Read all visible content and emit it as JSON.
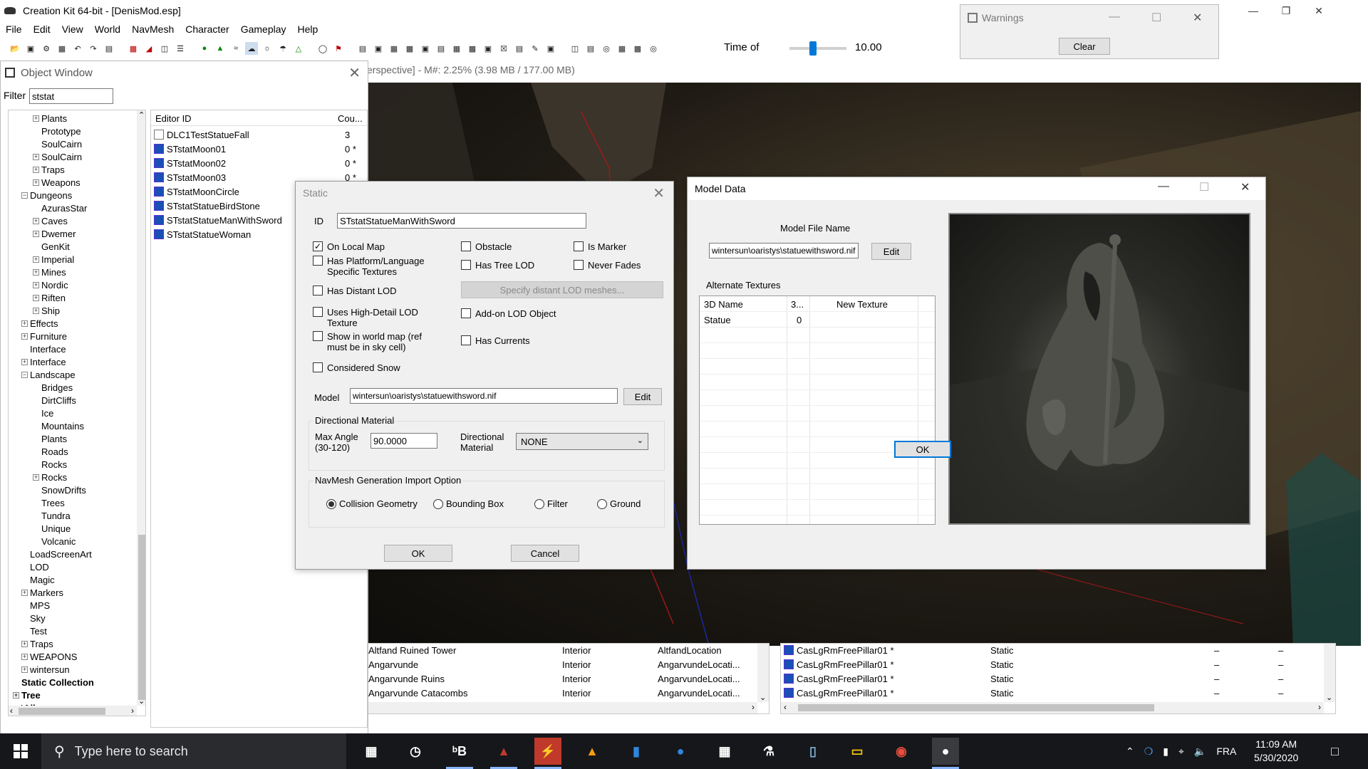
{
  "app": {
    "title": "Creation Kit 64-bit - [DenisMod.esp]"
  },
  "menu": [
    "File",
    "Edit",
    "View",
    "World",
    "NavMesh",
    "Character",
    "Gameplay",
    "Help"
  ],
  "toolbar": {
    "time_label": "Time of",
    "time_value": "10.00",
    "time_fraction": 0.4
  },
  "render": {
    "title": "erspective] - M#: 2.25% (3.98 MB / 177.00 MB)"
  },
  "warnings": {
    "title": "Warnings",
    "clear_label": "Clear"
  },
  "object_window": {
    "title": "Object Window",
    "filter_label": "Filter",
    "filter_value": "ststat",
    "tree": [
      {
        "label": "Plants",
        "expander": true,
        "level": 2
      },
      {
        "label": "Prototype",
        "expander": false,
        "level": 2
      },
      {
        "label": "SoulCairn",
        "expander": false,
        "level": 2
      },
      {
        "label": "SoulCairn",
        "expander": true,
        "level": 2
      },
      {
        "label": "Traps",
        "expander": true,
        "level": 2
      },
      {
        "label": "Weapons",
        "expander": true,
        "level": 2
      },
      {
        "label": "Dungeons",
        "expander": true,
        "level": 1,
        "open": true
      },
      {
        "label": "AzurasStar",
        "expander": false,
        "level": 2
      },
      {
        "label": "Caves",
        "expander": true,
        "level": 2
      },
      {
        "label": "Dwemer",
        "expander": true,
        "level": 2
      },
      {
        "label": "GenKit",
        "expander": false,
        "level": 2
      },
      {
        "label": "Imperial",
        "expander": true,
        "level": 2
      },
      {
        "label": "Mines",
        "expander": true,
        "level": 2
      },
      {
        "label": "Nordic",
        "expander": true,
        "level": 2
      },
      {
        "label": "Riften",
        "expander": true,
        "level": 2
      },
      {
        "label": "Ship",
        "expander": true,
        "level": 2
      },
      {
        "label": "Effects",
        "expander": true,
        "level": 1
      },
      {
        "label": "Furniture",
        "expander": true,
        "level": 1
      },
      {
        "label": "Interface",
        "expander": false,
        "level": 1
      },
      {
        "label": "Interface",
        "expander": true,
        "level": 1
      },
      {
        "label": "Landscape",
        "expander": true,
        "level": 1,
        "open": true
      },
      {
        "label": "Bridges",
        "expander": false,
        "level": 2
      },
      {
        "label": "DirtCliffs",
        "expander": false,
        "level": 2
      },
      {
        "label": "Ice",
        "expander": false,
        "level": 2
      },
      {
        "label": "Mountains",
        "expander": false,
        "level": 2
      },
      {
        "label": "Plants",
        "expander": false,
        "level": 2
      },
      {
        "label": "Roads",
        "expander": false,
        "level": 2
      },
      {
        "label": "Rocks",
        "expander": false,
        "level": 2
      },
      {
        "label": "Rocks",
        "expander": true,
        "level": 2
      },
      {
        "label": "SnowDrifts",
        "expander": false,
        "level": 2
      },
      {
        "label": "Trees",
        "expander": false,
        "level": 2
      },
      {
        "label": "Tundra",
        "expander": false,
        "level": 2
      },
      {
        "label": "Unique",
        "expander": false,
        "level": 2
      },
      {
        "label": "Volcanic",
        "expander": false,
        "level": 2
      },
      {
        "label": "LoadScreenArt",
        "expander": false,
        "level": 1
      },
      {
        "label": "LOD",
        "expander": false,
        "level": 1
      },
      {
        "label": "Magic",
        "expander": false,
        "level": 1
      },
      {
        "label": "Markers",
        "expander": true,
        "level": 1
      },
      {
        "label": "MPS",
        "expander": false,
        "level": 1
      },
      {
        "label": "Sky",
        "expander": false,
        "level": 1
      },
      {
        "label": "Test",
        "expander": false,
        "level": 1
      },
      {
        "label": "Traps",
        "expander": true,
        "level": 1
      },
      {
        "label": "WEAPONS",
        "expander": true,
        "level": 1
      },
      {
        "label": "wintersun",
        "expander": true,
        "level": 1
      },
      {
        "label": "Static Collection",
        "expander": false,
        "level": 0,
        "bold": true
      },
      {
        "label": "Tree",
        "expander": true,
        "level": 0,
        "bold": true
      },
      {
        "label": "*All",
        "expander": false,
        "level": -1,
        "bold": true
      }
    ],
    "list_headers": [
      "Editor ID",
      "Cou..."
    ],
    "list": [
      {
        "id": "DLC1TestStatueFall",
        "count": "3",
        "icon": "blank"
      },
      {
        "id": "STstatMoon01",
        "count": "0 *",
        "icon": "static"
      },
      {
        "id": "STstatMoon02",
        "count": "0 *",
        "icon": "static"
      },
      {
        "id": "STstatMoon03",
        "count": "0 *",
        "icon": "static"
      },
      {
        "id": "STstatMoonCircle",
        "count": "0 *",
        "icon": "static"
      },
      {
        "id": "STstatStatueBirdStone",
        "count": "",
        "icon": "static"
      },
      {
        "id": "STstatStatueManWithSword",
        "count": "",
        "icon": "static"
      },
      {
        "id": "STstatStatueWoman",
        "count": "",
        "icon": "static"
      }
    ]
  },
  "static_dialog": {
    "title": "Static",
    "id_label": "ID",
    "id_value": "STstatStatueManWithSword",
    "checks": {
      "on_local_map": {
        "label": "On Local Map",
        "checked": true
      },
      "obstacle": {
        "label": "Obstacle",
        "checked": false
      },
      "is_marker": {
        "label": "Is Marker",
        "checked": false
      },
      "has_platform": {
        "label": "Has Platform/Language Specific Textures",
        "checked": false
      },
      "has_tree_lod": {
        "label": "Has Tree LOD",
        "checked": false
      },
      "never_fades": {
        "label": "Never Fades",
        "checked": false
      },
      "has_distant_lod": {
        "label": "Has Distant LOD",
        "checked": false
      },
      "uses_high_detail": {
        "label": "Uses High-Detail LOD Texture",
        "checked": false
      },
      "addon_lod": {
        "label": "Add-on LOD Object",
        "checked": false
      },
      "show_world_map": {
        "label": "Show in world map (ref must be in sky cell)",
        "checked": false
      },
      "has_currents": {
        "label": "Has Currents",
        "checked": false
      },
      "considered_snow": {
        "label": "Considered Snow",
        "checked": false
      }
    },
    "specify_lod_label": "Specify distant LOD meshes...",
    "model_label": "Model",
    "model_value": "wintersun\\oaristys\\statuewithsword.nif",
    "edit_label": "Edit",
    "dir_material_group": "Directional Material",
    "max_angle_label": "Max Angle (30-120)",
    "max_angle_value": "90.0000",
    "dir_material_label": "Directional Material",
    "dir_material_value": "NONE",
    "navmesh_group": "NavMesh Generation Import Option",
    "navmesh_options": [
      {
        "label": "Collision Geometry",
        "selected": true
      },
      {
        "label": "Bounding Box",
        "selected": false
      },
      {
        "label": "Filter",
        "selected": false
      },
      {
        "label": "Ground",
        "selected": false
      }
    ],
    "ok_label": "OK",
    "cancel_label": "Cancel"
  },
  "model_dialog": {
    "title": "Model Data",
    "file_name_label": "Model File Name",
    "file_name_value": "wintersun\\oaristys\\statuewithsword.nif",
    "edit_label": "Edit",
    "alt_textures_label": "Alternate Textures",
    "alt_headers": [
      "3D Name",
      "3...",
      "New Texture"
    ],
    "alt_rows": [
      {
        "name": "Statue",
        "idx": "0",
        "texture": ""
      }
    ],
    "ok_label": "OK"
  },
  "bottom_left_grid": [
    {
      "name": "Altfand Ruined Tower",
      "type": "Interior",
      "location": "AltfandLocation"
    },
    {
      "name": "Angarvunde",
      "type": "Interior",
      "location": "AngarvundeLocati..."
    },
    {
      "name": "Angarvunde Ruins",
      "type": "Interior",
      "location": "AngarvundeLocati..."
    },
    {
      "name": "Angarvunde Catacombs",
      "type": "Interior",
      "location": "AngarvundeLocati..."
    }
  ],
  "bottom_right_grid": [
    {
      "name": "CasLgRmFreePillar01 *",
      "type": "Static",
      "a": "–",
      "b": "–"
    },
    {
      "name": "CasLgRmFreePillar01 *",
      "type": "Static",
      "a": "–",
      "b": "–"
    },
    {
      "name": "CasLgRmFreePillar01 *",
      "type": "Static",
      "a": "–",
      "b": "–"
    },
    {
      "name": "CasLgRmFreePillar01 *",
      "type": "Static",
      "a": "–",
      "b": "–"
    }
  ],
  "taskbar": {
    "search_placeholder": "Type here to search",
    "language": "FRA",
    "time": "11:09 AM",
    "date": "5/30/2020"
  }
}
